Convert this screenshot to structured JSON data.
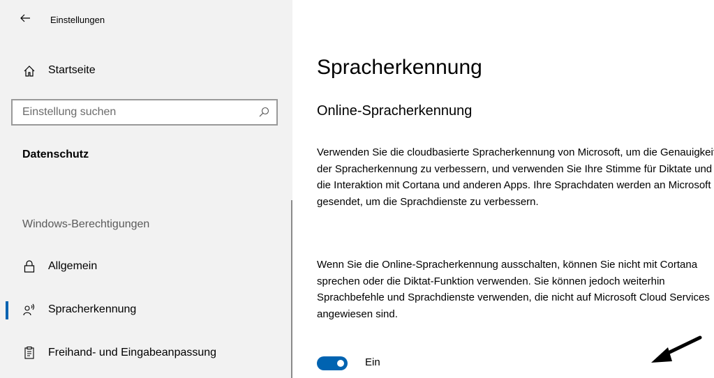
{
  "window": {
    "title": "Einstellungen"
  },
  "sidebar": {
    "home_label": "Startseite",
    "search": {
      "placeholder": "Einstellung suchen"
    },
    "section_heading": "Datenschutz",
    "group_heading": "Windows-Berechtigungen",
    "items": [
      {
        "label": "Allgemein",
        "icon": "lock-icon",
        "active": false
      },
      {
        "label": "Spracherkennung",
        "icon": "speech-icon",
        "active": true
      },
      {
        "label": "Freihand- und Eingabeanpassung",
        "icon": "clipboard-icon",
        "active": false
      }
    ]
  },
  "main": {
    "title": "Spracherkennung",
    "subtitle": "Online-Spracherkennung",
    "paragraphs": [
      "Verwenden Sie die cloudbasierte Spracherkennung von Microsoft, um die Genauigkeit der Spracherkennung zu verbessern, und verwenden Sie Ihre Stimme für Diktate und die Interaktion mit Cortana und anderen Apps. Ihre Sprachdaten werden an Microsoft gesendet, um die Sprachdienste zu verbessern.",
      "Wenn Sie die Online-Spracherkennung ausschalten, können Sie nicht mit Cortana sprechen oder die Diktat-Funktion verwenden. Sie können jedoch weiterhin Sprachbefehle und Sprachdienste verwenden, die nicht auf Microsoft Cloud Services angewiesen sind."
    ],
    "toggle": {
      "state_label": "Ein",
      "on": true
    }
  },
  "colors": {
    "accent": "#0063b1",
    "sidebar_bg": "#f2f2f2"
  }
}
